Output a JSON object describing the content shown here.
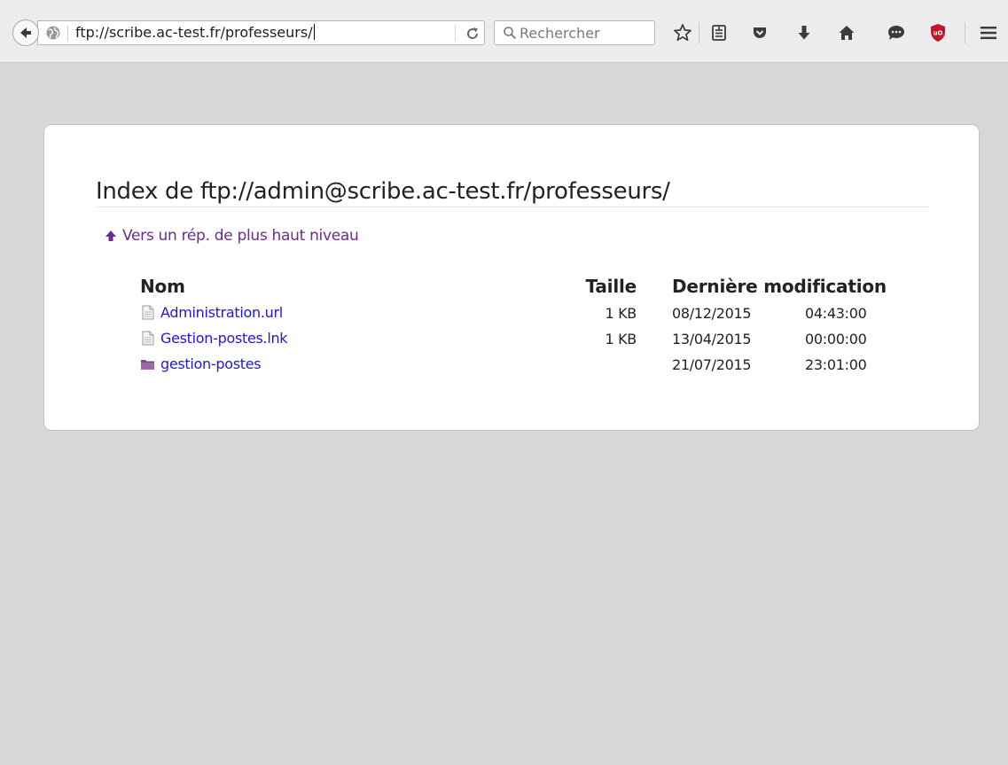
{
  "browser": {
    "url": "ftp://scribe.ac-test.fr/professeurs/",
    "search_placeholder": "Rechercher",
    "toolbar_icons": [
      "back-icon",
      "globe-icon",
      "reload-icon",
      "search-icon",
      "bookmark-star-icon",
      "reader-list-icon",
      "pocket-icon",
      "download-icon",
      "home-icon",
      "chat-icon",
      "ublock-icon",
      "menu-icon"
    ]
  },
  "page": {
    "heading": "Index de ftp://admin@scribe.ac-test.fr/professeurs/",
    "parent_link": "Vers un rép. de plus haut niveau",
    "columns": {
      "name": "Nom",
      "size": "Taille",
      "modified": "Dernière modification"
    },
    "entries": [
      {
        "name": "Administration.url",
        "type": "file",
        "size": "1 KB",
        "date": "08/12/2015",
        "time": "04:43:00"
      },
      {
        "name": "Gestion-postes.lnk",
        "type": "file",
        "size": "1 KB",
        "date": "13/04/2015",
        "time": "00:00:00"
      },
      {
        "name": "gestion-postes",
        "type": "folder",
        "size": "",
        "date": "21/07/2015",
        "time": "23:01:00"
      }
    ]
  },
  "colors": {
    "background": "#d7d7d7",
    "link": "#2218ce",
    "visited_link": "#6b2c8a",
    "ublock_red": "#c0162b"
  }
}
